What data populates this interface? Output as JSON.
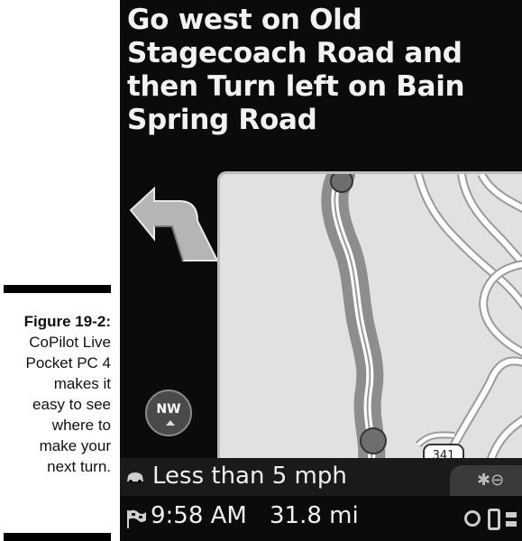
{
  "caption": {
    "label": "Figure 19-2:",
    "lines": [
      "CoPilot Live",
      "Pocket PC 4",
      "makes it",
      "easy to see",
      "where to",
      "make your",
      "next turn."
    ]
  },
  "navigation": {
    "instruction_lines": [
      "Go west on Old",
      "Stagecoach Road and",
      "then Turn left on Bain",
      "Spring Road"
    ],
    "compass_heading": "NW",
    "road_shield": "341"
  },
  "status": {
    "speed_text": "Less than 5 mph",
    "eta": "9:58 AM",
    "distance": "31.8 mi"
  },
  "icons": {
    "turn": "turn-left-arrow-icon",
    "speed": "car-icon",
    "eta": "checkered-flag-icon",
    "walk": "pedestrian-icon",
    "zoom": "zoom-icon",
    "info": "info-icon",
    "menu": "menu-icon"
  },
  "colors": {
    "screen_bg": "#0b0b0b",
    "map_bg": "#e1e1e1",
    "route": "#9a9a9a",
    "text": "#f2f2f2"
  }
}
